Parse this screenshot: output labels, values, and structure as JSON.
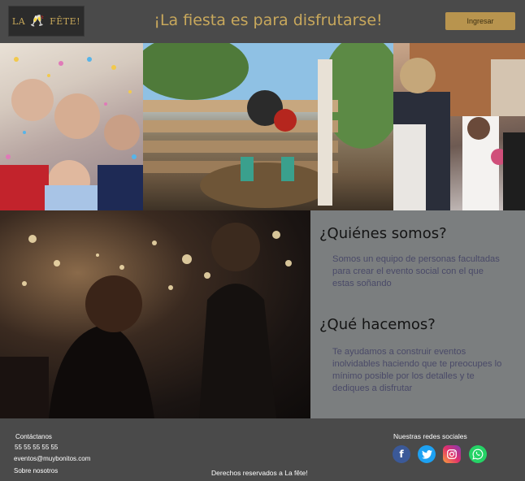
{
  "header": {
    "logo_text_left": "LA",
    "logo_text_right": "FÊTE!",
    "title": "¡La fiesta es para disfrutarse!",
    "login_label": "Ingresar"
  },
  "about": {
    "who_heading": "¿Quiénes somos?",
    "who_text": "Somos un equipo de personas facultadas para crear  el evento social con el que estas soñando",
    "what_heading": "¿Qué hacemos?",
    "what_text": "Te  ayudamos a construir eventos inolvidables haciendo que te preocupes lo mínimo posible por los detalles y te dediques a disfrutar"
  },
  "footer": {
    "contact_label": "Contáctanos",
    "phone": "55 55 55 55 55",
    "email": "eventos@muybonitos.com",
    "about_link": "Sobre nosotros",
    "social_label": "Nuestras redes sociales",
    "rights": "Derechos reservados a La fête!"
  },
  "social_icons": [
    "facebook-icon",
    "twitter-icon",
    "instagram-icon",
    "whatsapp-icon"
  ]
}
